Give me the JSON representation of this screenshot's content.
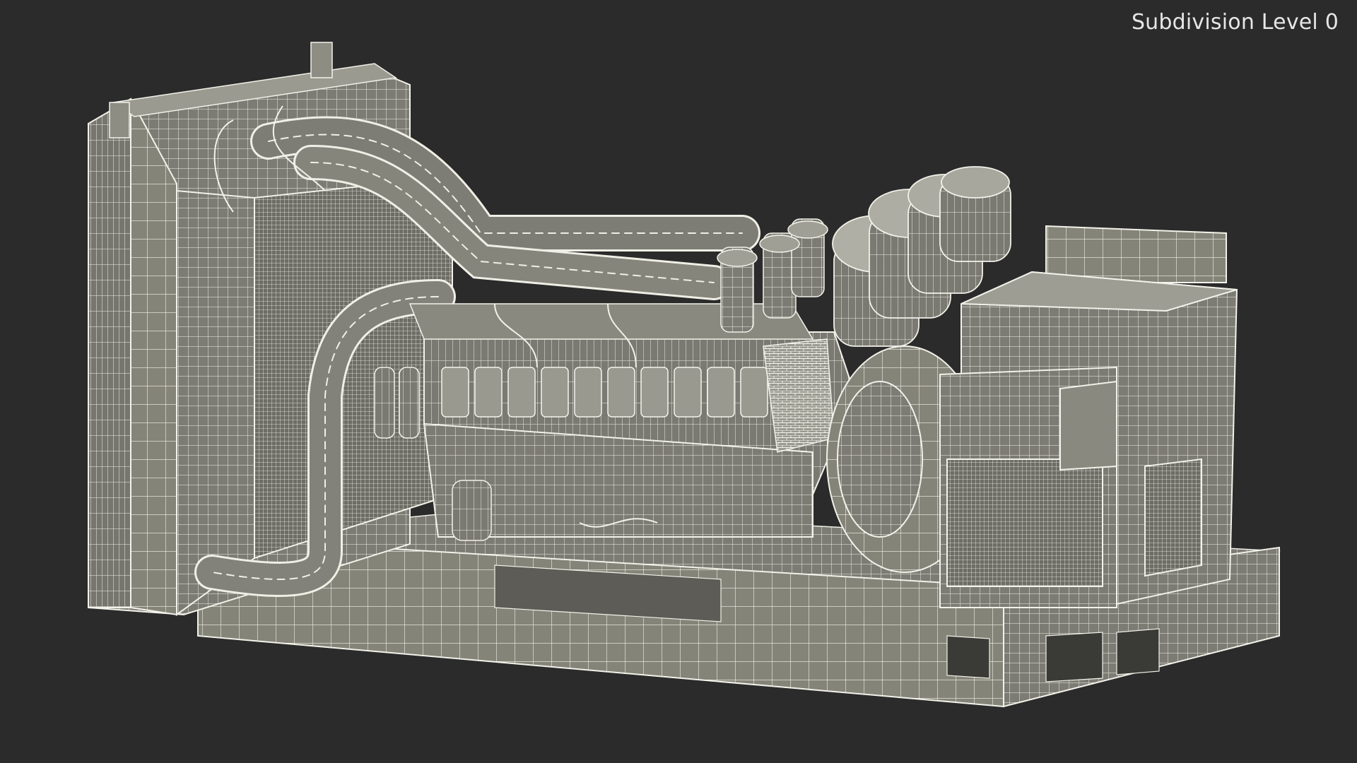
{
  "viewport": {
    "label": "Subdivision Level 0",
    "background_color": "#2b2b2b",
    "label_color": "#e6e6e6",
    "model_fill_color": "#8c8b82",
    "model_wire_color": "#f2f2ea"
  }
}
